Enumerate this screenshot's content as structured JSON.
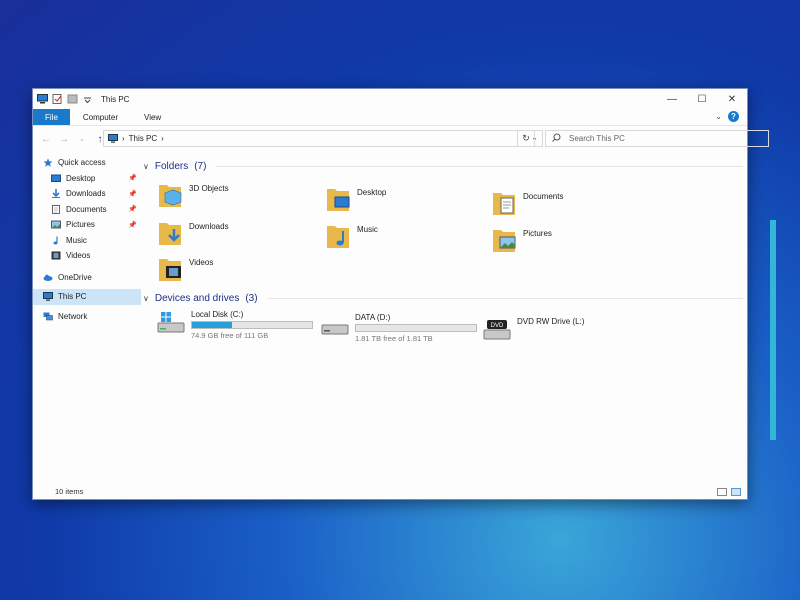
{
  "window": {
    "title": "This PC"
  },
  "ribbon": {
    "tabs": [
      "File",
      "Computer",
      "View"
    ]
  },
  "address": {
    "crumbs": [
      "This PC"
    ]
  },
  "search": {
    "placeholder": "Search This PC"
  },
  "sidebar": {
    "quick_access": "Quick access",
    "items": [
      "Desktop",
      "Downloads",
      "Documents",
      "Pictures",
      "Music",
      "Videos"
    ],
    "onedrive": "OneDrive",
    "this_pc": "This PC",
    "network": "Network"
  },
  "folders": {
    "title": "Folders",
    "count": "(7)",
    "items": [
      "3D Objects",
      "Desktop",
      "Documents",
      "Downloads",
      "Music",
      "Pictures",
      "Videos"
    ]
  },
  "drives": {
    "title": "Devices and drives",
    "count": "(3)",
    "items": [
      {
        "name": "Local Disk (C:)",
        "free": "74.9 GB free of 111 GB",
        "used_fraction": 0.33
      },
      {
        "name": "DATA (D:)",
        "free": "1.81 TB free of 1.81 TB",
        "used_fraction": 0.0
      },
      {
        "name": "DVD RW Drive (L:)"
      }
    ],
    "dvd_badge": "DVD"
  },
  "status": {
    "items": "10 items"
  },
  "colors": {
    "accent": "#1979ca",
    "folder": "#e8b84a",
    "selected": "#cce4f7",
    "bar_fill": "#26a0da"
  }
}
